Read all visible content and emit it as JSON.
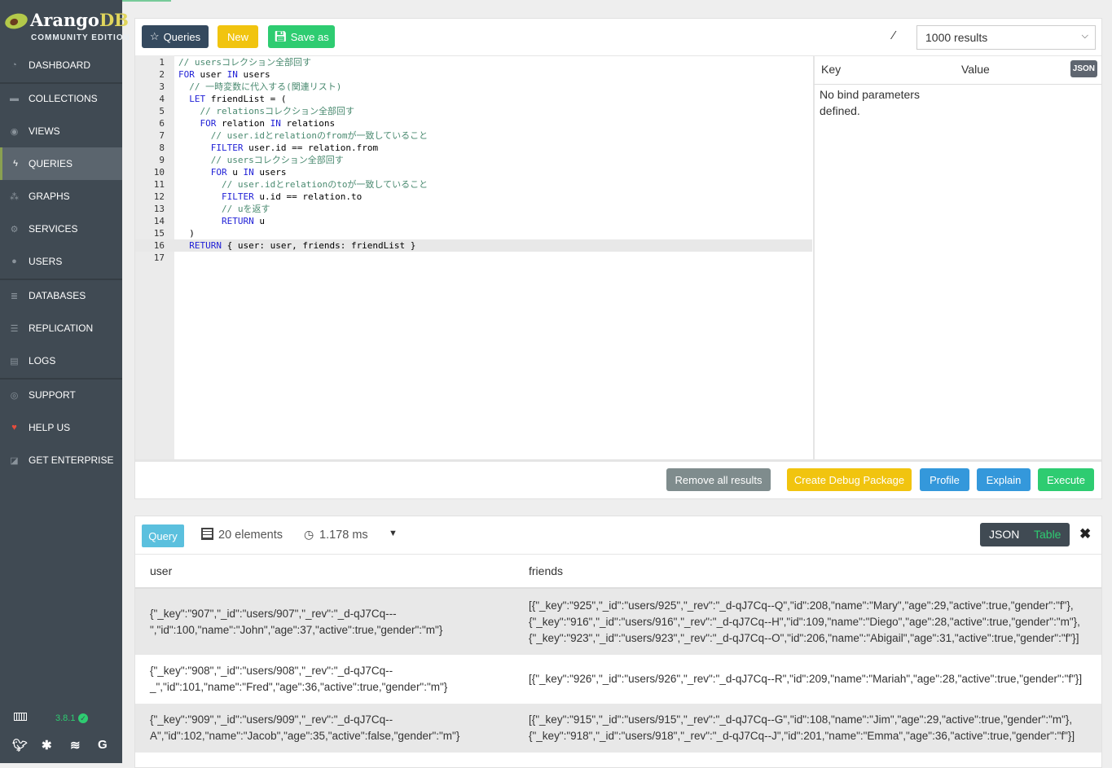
{
  "brand": {
    "name_a": "Arango",
    "name_b": "DB",
    "edition": "COMMUNITY EDITION"
  },
  "sidebar": {
    "items": [
      {
        "label": "DASHBOARD",
        "icon": "dashboard-icon",
        "glyph": "◔"
      },
      {
        "label": "COLLECTIONS",
        "icon": "folder-icon",
        "glyph": "▬"
      },
      {
        "label": "VIEWS",
        "icon": "eye-icon",
        "glyph": "◉"
      },
      {
        "label": "QUERIES",
        "icon": "bolt-icon",
        "glyph": "ϟ",
        "active": true
      },
      {
        "label": "GRAPHS",
        "icon": "sitemap-icon",
        "glyph": "⁂"
      },
      {
        "label": "SERVICES",
        "icon": "cogs-icon",
        "glyph": "⚙"
      },
      {
        "label": "USERS",
        "icon": "users-icon",
        "glyph": "●"
      },
      {
        "label": "DATABASES",
        "icon": "database-icon",
        "glyph": "≣"
      },
      {
        "label": "REPLICATION",
        "icon": "server-icon",
        "glyph": "☰"
      },
      {
        "label": "LOGS",
        "icon": "file-icon",
        "glyph": "▤"
      },
      {
        "label": "SUPPORT",
        "icon": "life-ring-icon",
        "glyph": "◎"
      },
      {
        "label": "HELP US",
        "icon": "heart-icon",
        "glyph": "♥"
      },
      {
        "label": "GET ENTERPRISE",
        "icon": "external-icon",
        "glyph": "◪"
      }
    ],
    "version": "3.8.1"
  },
  "toolbar": {
    "queries": "Queries",
    "new": "New",
    "save_as": "Save as",
    "limit": "1000 results"
  },
  "editor": {
    "lines": [
      [
        [
          "c",
          "// usersコレクション全部回す"
        ]
      ],
      [
        [
          "k",
          "FOR"
        ],
        [
          "x",
          " user "
        ],
        [
          "k",
          "IN"
        ],
        [
          "x",
          " users"
        ]
      ],
      [
        [
          "x",
          "  "
        ],
        [
          "c",
          "// 一時変数に代入する(関連リスト)"
        ]
      ],
      [
        [
          "x",
          "  "
        ],
        [
          "k",
          "LET"
        ],
        [
          "x",
          " friendList = ("
        ]
      ],
      [
        [
          "x",
          "    "
        ],
        [
          "c",
          "// relationsコレクション全部回す"
        ]
      ],
      [
        [
          "x",
          "    "
        ],
        [
          "k",
          "FOR"
        ],
        [
          "x",
          " relation "
        ],
        [
          "k",
          "IN"
        ],
        [
          "x",
          " relations"
        ]
      ],
      [
        [
          "x",
          "      "
        ],
        [
          "c",
          "// user.idとrelationのfromが一致していること"
        ]
      ],
      [
        [
          "x",
          "      "
        ],
        [
          "k",
          "FILTER"
        ],
        [
          "x",
          " user.id == relation.from"
        ]
      ],
      [
        [
          "x",
          "      "
        ],
        [
          "c",
          "// usersコレクション全部回す"
        ]
      ],
      [
        [
          "x",
          "      "
        ],
        [
          "k",
          "FOR"
        ],
        [
          "x",
          " u "
        ],
        [
          "k",
          "IN"
        ],
        [
          "x",
          " users"
        ]
      ],
      [
        [
          "x",
          "        "
        ],
        [
          "c",
          "// user.idとrelationのtoが一致していること"
        ]
      ],
      [
        [
          "x",
          "        "
        ],
        [
          "k",
          "FILTER"
        ],
        [
          "x",
          " u.id == relation.to"
        ]
      ],
      [
        [
          "x",
          "        "
        ],
        [
          "c",
          "// uを返す"
        ]
      ],
      [
        [
          "x",
          "        "
        ],
        [
          "k",
          "RETURN"
        ],
        [
          "x",
          " u"
        ]
      ],
      [
        [
          "x",
          "  )"
        ]
      ],
      [
        [
          "x",
          "  "
        ],
        [
          "k",
          "RETURN"
        ],
        [
          "x",
          " { user: user, friends: friendList } "
        ]
      ],
      []
    ],
    "active_line": 16
  },
  "bind_params": {
    "key": "Key",
    "value": "Value",
    "json": "JSON",
    "empty": "No bind parameters defined."
  },
  "actions": {
    "remove": "Remove all results",
    "debug": "Create Debug Package",
    "profile": "Profile",
    "explain": "Explain",
    "execute": "Execute"
  },
  "results": {
    "query_tab": "Query",
    "elements": "20 elements",
    "time": "1.178 ms",
    "json": "JSON",
    "table": "Table",
    "columns": [
      "user",
      "friends"
    ],
    "rows": [
      {
        "user": "{\"_key\":\"907\",\"_id\":\"users/907\",\"_rev\":\"_d-qJ7Cq---\",\"id\":100,\"name\":\"John\",\"age\":37,\"active\":true,\"gender\":\"m\"}",
        "friends": "[{\"_key\":\"925\",\"_id\":\"users/925\",\"_rev\":\"_d-qJ7Cq--Q\",\"id\":208,\"name\":\"Mary\",\"age\":29,\"active\":true,\"gender\":\"f\"}, {\"_key\":\"916\",\"_id\":\"users/916\",\"_rev\":\"_d-qJ7Cq--H\",\"id\":109,\"name\":\"Diego\",\"age\":28,\"active\":true,\"gender\":\"m\"}, {\"_key\":\"923\",\"_id\":\"users/923\",\"_rev\":\"_d-qJ7Cq--O\",\"id\":206,\"name\":\"Abigail\",\"age\":31,\"active\":true,\"gender\":\"f\"}]"
      },
      {
        "user": "{\"_key\":\"908\",\"_id\":\"users/908\",\"_rev\":\"_d-qJ7Cq--_\",\"id\":101,\"name\":\"Fred\",\"age\":36,\"active\":true,\"gender\":\"m\"}",
        "friends": "[{\"_key\":\"926\",\"_id\":\"users/926\",\"_rev\":\"_d-qJ7Cq--R\",\"id\":209,\"name\":\"Mariah\",\"age\":28,\"active\":true,\"gender\":\"f\"}]"
      },
      {
        "user": "{\"_key\":\"909\",\"_id\":\"users/909\",\"_rev\":\"_d-qJ7Cq--A\",\"id\":102,\"name\":\"Jacob\",\"age\":35,\"active\":false,\"gender\":\"m\"}",
        "friends": "[{\"_key\":\"915\",\"_id\":\"users/915\",\"_rev\":\"_d-qJ7Cq--G\",\"id\":108,\"name\":\"Jim\",\"age\":29,\"active\":true,\"gender\":\"m\"}, {\"_key\":\"918\",\"_id\":\"users/918\",\"_rev\":\"_d-qJ7Cq--J\",\"id\":201,\"name\":\"Emma\",\"age\":36,\"active\":true,\"gender\":\"f\"}]"
      }
    ]
  },
  "colors": {
    "sidebar": "#404a53",
    "queries_btn": "#34495e",
    "new_btn": "#f1c40f",
    "save_btn": "#2ecc71",
    "remove_btn": "#7f8c8d",
    "profile_btn": "#3498db",
    "query_tab": "#5bc0de"
  }
}
